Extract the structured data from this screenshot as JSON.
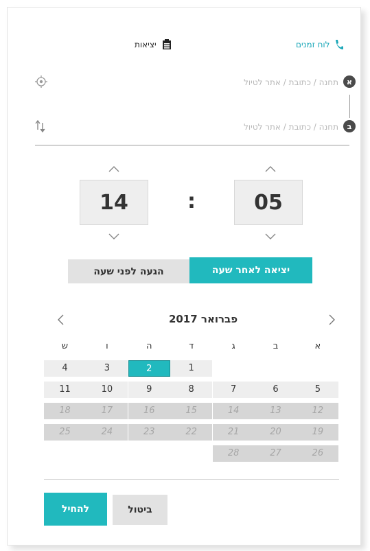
{
  "header": {
    "schedule_tab": "לוח זמנים",
    "departures_tab": "יציאות"
  },
  "route": {
    "from_badge": "א",
    "to_badge": "ב",
    "from_placeholder": "תחנה / כתובת / אתר לטיול",
    "to_placeholder": "תחנה / כתובת / אתר לטיול",
    "from_value": "",
    "to_value": ""
  },
  "time": {
    "hours": "14",
    "separator": ":",
    "minutes": "05"
  },
  "mode": {
    "depart_after": "יציאה לאחר שעה",
    "arrive_before": "הגעה לפני שעה"
  },
  "calendar": {
    "month_title": "פברואר 2017",
    "weekdays": [
      "א",
      "ב",
      "ג",
      "ד",
      "ה",
      "ו",
      "ש"
    ],
    "rows": [
      [
        "",
        "",
        "",
        "1",
        "2",
        "3",
        "4"
      ],
      [
        "5",
        "6",
        "7",
        "8",
        "9",
        "10",
        "11"
      ],
      [
        "12",
        "13",
        "14",
        "15",
        "16",
        "17",
        "18"
      ],
      [
        "19",
        "20",
        "21",
        "22",
        "23",
        "24",
        "25"
      ],
      [
        "26",
        "27",
        "28",
        "",
        "",
        "",
        ""
      ]
    ],
    "selected_day": "2",
    "selectable_through": "11"
  },
  "footer": {
    "start_label": "להחיל",
    "cancel_label": "ביטול"
  },
  "colors": {
    "accent": "#21b9be",
    "dark": "#333333",
    "badge": "#4a4a4a"
  }
}
